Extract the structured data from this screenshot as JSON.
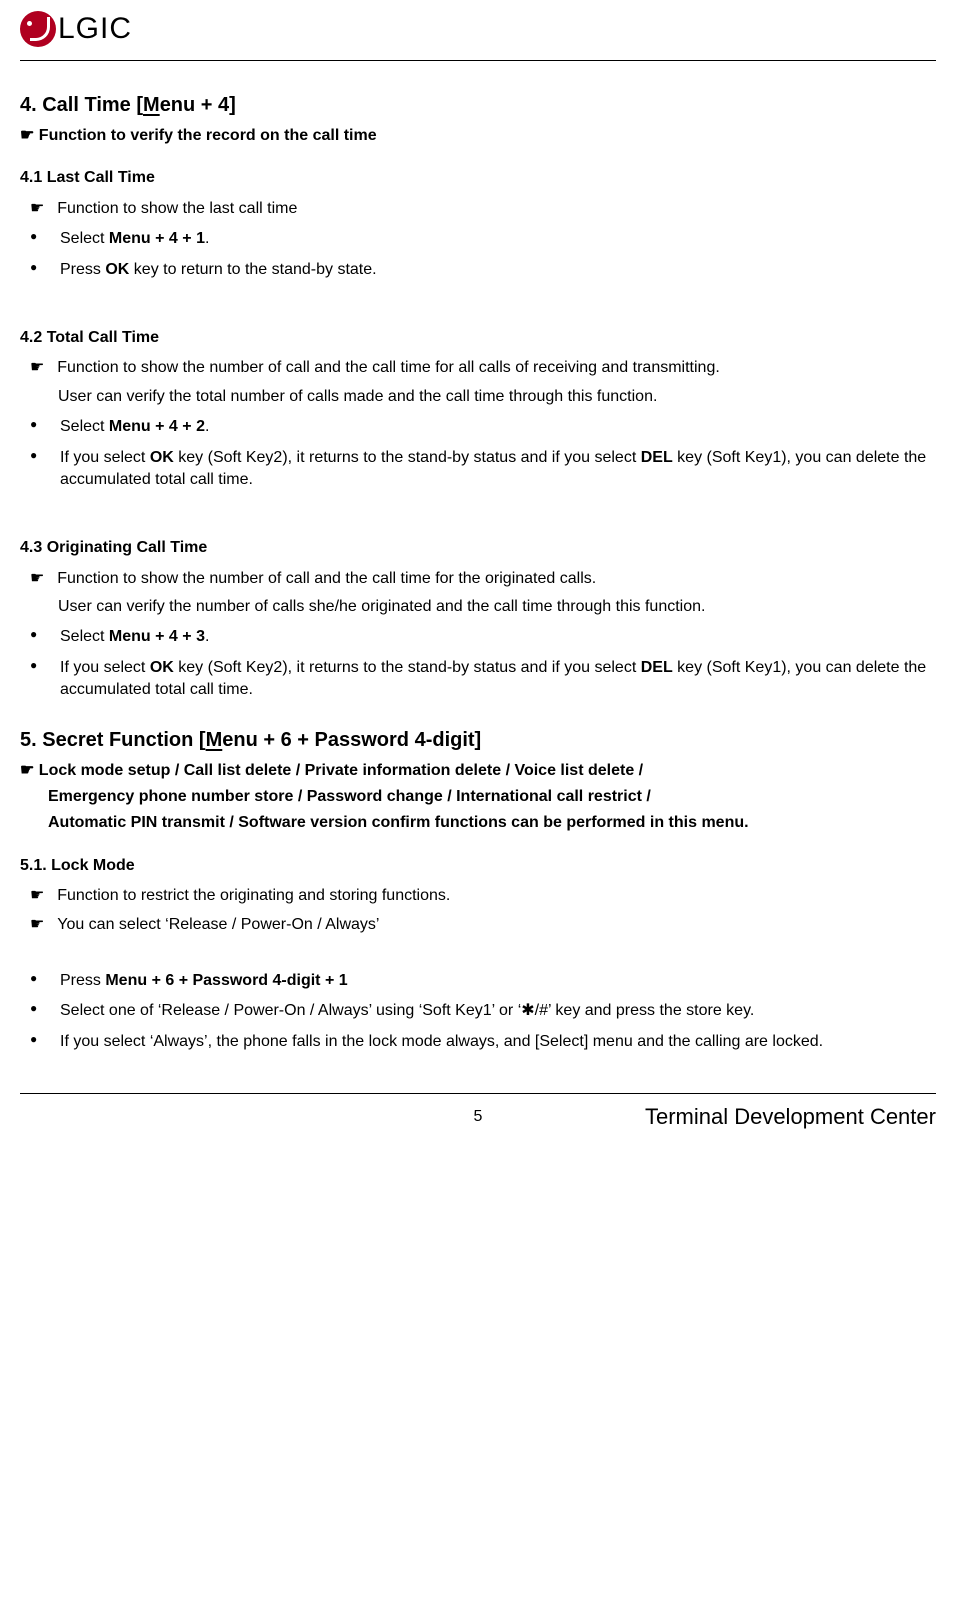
{
  "header": {
    "brand": "LGIC"
  },
  "s4": {
    "title_prefix": "4. Call Time [",
    "title_underlined": "M",
    "title_suffix": "enu + 4]",
    "intro": "☛ Function to verify the record on the call time",
    "s41": {
      "title": "4.1 Last Call Time",
      "pointer": "Function to show the last call time",
      "b1_pre": "Select ",
      "b1_bold": "Menu + 4 + 1",
      "b1_post": ".",
      "b2_pre": "Press ",
      "b2_bold": "OK",
      "b2_post": " key to return to the stand-by state."
    },
    "s42": {
      "title": "4.2 Total Call Time",
      "pointer": "Function to show the number of call and the call time for all calls of receiving and transmitting.",
      "pointer_cont": "User can verify the total number of calls made and the call time through this function.",
      "b1_pre": "Select ",
      "b1_bold": "Menu + 4 + 2",
      "b1_post": ".",
      "b2_p1": "If you select ",
      "b2_b1": "OK",
      "b2_p2": " key (Soft Key2), it returns to the stand-by status and if you select ",
      "b2_b2": "DEL",
      "b2_p3": " key (Soft Key1), you can delete the accumulated total call time."
    },
    "s43": {
      "title": "4.3 Originating Call Time",
      "pointer": "Function to show the number of call and the call time for the originated calls.",
      "pointer_cont": "User can verify the number of calls she/he originated and the call time through this function.",
      "b1_pre": "Select ",
      "b1_bold": "Menu + 4 + 3",
      "b1_post": ".",
      "b2_p1": "If you select ",
      "b2_b1": "OK",
      "b2_p2": " key (Soft Key2), it returns to the stand-by status and if you select ",
      "b2_b2": "DEL",
      "b2_p3": " key (Soft Key1), you can delete the accumulated total call time."
    }
  },
  "s5": {
    "title_prefix": "5. Secret Function [",
    "title_underlined": "M",
    "title_suffix": "enu + 6 + Password 4-digit]",
    "intro_l1": "☛ Lock mode setup / Call list delete / Private information delete / Voice list delete /",
    "intro_l2": "Emergency phone number store / Password change / International call restrict /",
    "intro_l3": "Automatic PIN transmit / Software version confirm functions can be performed in this menu.",
    "s51": {
      "title": "5.1. Lock Mode",
      "pointer1": "Function to restrict the originating and storing functions.",
      "pointer2": "You can select ‘Release / Power-On / Always’",
      "b1_pre": "Press ",
      "b1_bold": "Menu + 6 + Password 4-digit + 1",
      "b2": "Select one of ‘Release / Power-On / Always’ using ‘Soft Key1’ or ‘✱/#’ key and press the store key.",
      "b3": "If you select ‘Always’, the phone falls in the lock mode always, and [Select] menu and the calling are locked."
    }
  },
  "footer": {
    "page": "5",
    "right": "Terminal Development Center"
  },
  "sym": {
    "pointer": "☛"
  }
}
